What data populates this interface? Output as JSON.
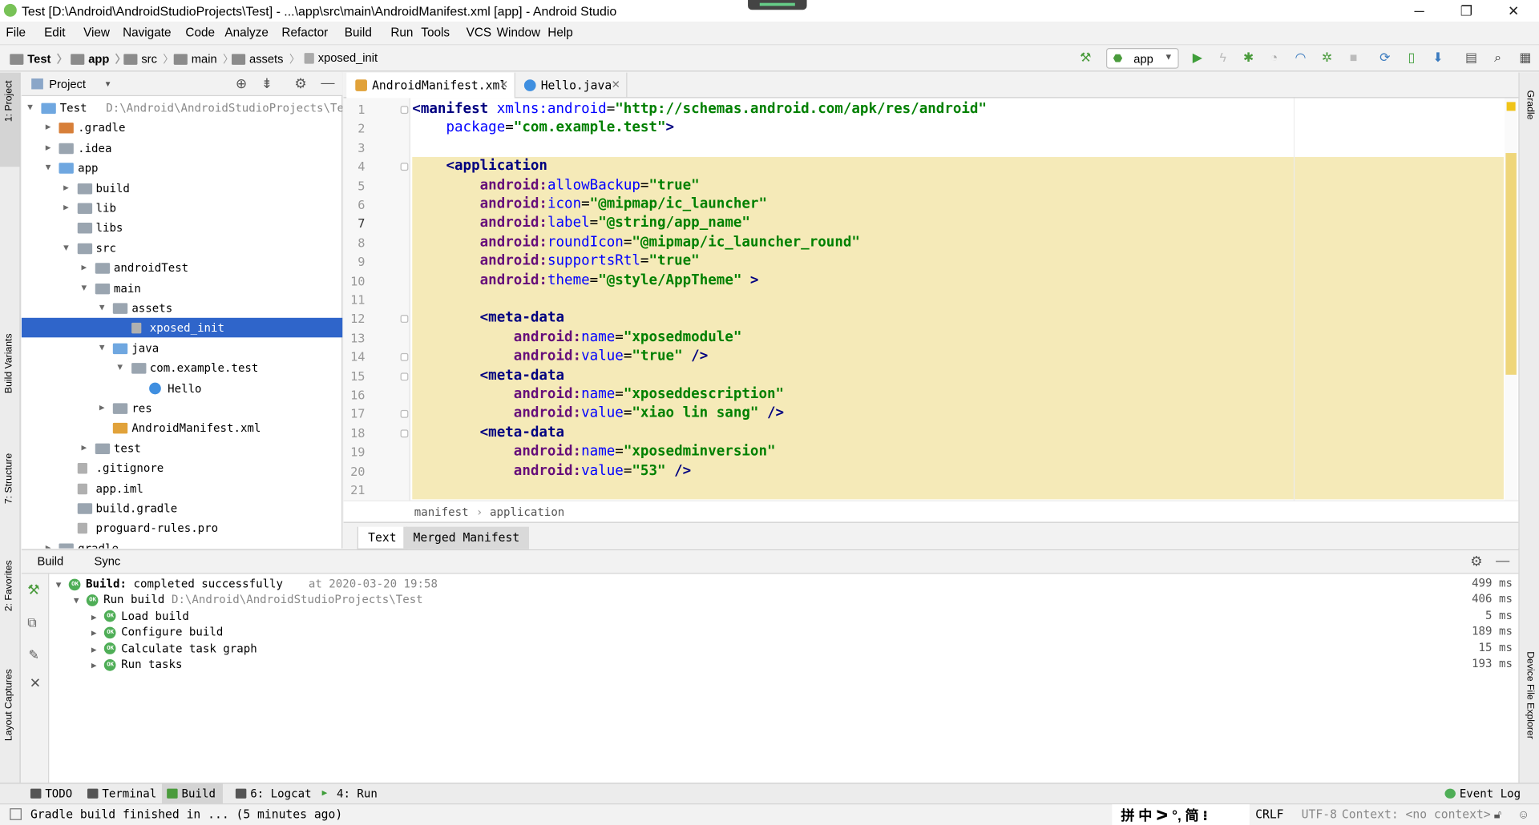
{
  "window": {
    "title": "Test [D:\\Android\\AndroidStudioProjects\\Test] - ...\\app\\src\\main\\AndroidManifest.xml [app] - Android Studio"
  },
  "menu": [
    "File",
    "Edit",
    "View",
    "Navigate",
    "Code",
    "Analyze",
    "Refactor",
    "Build",
    "Run",
    "Tools",
    "VCS",
    "Window",
    "Help"
  ],
  "breadcrumbs": [
    "Test",
    "app",
    "src",
    "main",
    "assets",
    "xposed_init"
  ],
  "toolbar": {
    "run_config": "app"
  },
  "left_strip": {
    "project": "1: Project",
    "build_variants": "Build Variants",
    "structure": "7: Structure",
    "favorites": "2: Favorites",
    "layout_captures": "Layout Captures"
  },
  "right_strip": {
    "gradle": "Gradle",
    "device_file_explorer": "Device File Explorer"
  },
  "project_panel": {
    "title": "Project",
    "tree": [
      {
        "label": "Test",
        "path": "D:\\Android\\AndroidStudioProjects\\Test",
        "depth": 0,
        "expanded": "open",
        "icon": "module"
      },
      {
        "label": ".gradle",
        "depth": 1,
        "expanded": "closed",
        "icon": "folder-orange"
      },
      {
        "label": ".idea",
        "depth": 1,
        "expanded": "closed",
        "icon": "folder"
      },
      {
        "label": "app",
        "depth": 1,
        "expanded": "open",
        "icon": "module"
      },
      {
        "label": "build",
        "depth": 2,
        "expanded": "closed",
        "icon": "folder"
      },
      {
        "label": "lib",
        "depth": 2,
        "expanded": "closed",
        "icon": "folder"
      },
      {
        "label": "libs",
        "depth": 2,
        "expanded": "none",
        "icon": "folder"
      },
      {
        "label": "src",
        "depth": 2,
        "expanded": "open",
        "icon": "folder"
      },
      {
        "label": "androidTest",
        "depth": 3,
        "expanded": "closed",
        "icon": "folder"
      },
      {
        "label": "main",
        "depth": 3,
        "expanded": "open",
        "icon": "folder"
      },
      {
        "label": "assets",
        "depth": 4,
        "expanded": "open",
        "icon": "folder"
      },
      {
        "label": "xposed_init",
        "depth": 5,
        "expanded": "none",
        "icon": "file",
        "selected": true
      },
      {
        "label": "java",
        "depth": 4,
        "expanded": "open",
        "icon": "folder-blue"
      },
      {
        "label": "com.example.test",
        "depth": 5,
        "expanded": "open",
        "icon": "package"
      },
      {
        "label": "Hello",
        "depth": 6,
        "expanded": "none",
        "icon": "class"
      },
      {
        "label": "res",
        "depth": 4,
        "expanded": "closed",
        "icon": "folder"
      },
      {
        "label": "AndroidManifest.xml",
        "depth": 4,
        "expanded": "none",
        "icon": "xml"
      },
      {
        "label": "test",
        "depth": 3,
        "expanded": "closed",
        "icon": "folder"
      },
      {
        "label": ".gitignore",
        "depth": 2,
        "expanded": "none",
        "icon": "file"
      },
      {
        "label": "app.iml",
        "depth": 2,
        "expanded": "none",
        "icon": "file"
      },
      {
        "label": "build.gradle",
        "depth": 2,
        "expanded": "none",
        "icon": "gradle"
      },
      {
        "label": "proguard-rules.pro",
        "depth": 2,
        "expanded": "none",
        "icon": "file"
      },
      {
        "label": "gradle",
        "depth": 1,
        "expanded": "closed",
        "icon": "folder"
      }
    ]
  },
  "editor": {
    "tabs": [
      {
        "label": "AndroidManifest.xml",
        "active": true
      },
      {
        "label": "Hello.java",
        "active": false
      }
    ],
    "line_numbers": [
      "1",
      "2",
      "3",
      "4",
      "5",
      "6",
      "7",
      "8",
      "9",
      "10",
      "11",
      "12",
      "13",
      "14",
      "15",
      "16",
      "17",
      "18",
      "19",
      "20",
      "21"
    ],
    "code": [
      [
        [
          "tg",
          "<manifest "
        ],
        [
          "at",
          "xmlns:android"
        ],
        [
          "pl",
          "="
        ],
        [
          "av",
          "\"http://schemas.android.com/apk/res/android\""
        ]
      ],
      [
        [
          "pl",
          "    "
        ],
        [
          "at",
          "package"
        ],
        [
          "pl",
          "="
        ],
        [
          "av",
          "\"com.example.test\""
        ],
        [
          "tg",
          ">"
        ]
      ],
      [],
      [
        [
          "pl",
          "    "
        ],
        [
          "tg",
          "<application"
        ]
      ],
      [
        [
          "pl",
          "        "
        ],
        [
          "ns",
          "android:"
        ],
        [
          "at",
          "allowBackup"
        ],
        [
          "pl",
          "="
        ],
        [
          "av",
          "\"true\""
        ]
      ],
      [
        [
          "pl",
          "        "
        ],
        [
          "ns",
          "android:"
        ],
        [
          "at",
          "icon"
        ],
        [
          "pl",
          "="
        ],
        [
          "av",
          "\"@mipmap/ic_launcher\""
        ]
      ],
      [
        [
          "pl",
          "        "
        ],
        [
          "ns",
          "android:"
        ],
        [
          "at",
          "label"
        ],
        [
          "pl",
          "="
        ],
        [
          "av",
          "\"@string/app_name\""
        ]
      ],
      [
        [
          "pl",
          "        "
        ],
        [
          "ns",
          "android:"
        ],
        [
          "at",
          "roundIcon"
        ],
        [
          "pl",
          "="
        ],
        [
          "av",
          "\"@mipmap/ic_launcher_round\""
        ]
      ],
      [
        [
          "pl",
          "        "
        ],
        [
          "ns",
          "android:"
        ],
        [
          "at",
          "supportsRtl"
        ],
        [
          "pl",
          "="
        ],
        [
          "av",
          "\"true\""
        ]
      ],
      [
        [
          "pl",
          "        "
        ],
        [
          "ns",
          "android:"
        ],
        [
          "at",
          "theme"
        ],
        [
          "pl",
          "="
        ],
        [
          "av",
          "\"@style/AppTheme\""
        ],
        [
          "tg",
          " >"
        ]
      ],
      [],
      [
        [
          "pl",
          "        "
        ],
        [
          "tg",
          "<meta-data"
        ]
      ],
      [
        [
          "pl",
          "            "
        ],
        [
          "ns",
          "android:"
        ],
        [
          "at",
          "name"
        ],
        [
          "pl",
          "="
        ],
        [
          "av",
          "\"xposedmodule\""
        ]
      ],
      [
        [
          "pl",
          "            "
        ],
        [
          "ns",
          "android:"
        ],
        [
          "at",
          "value"
        ],
        [
          "pl",
          "="
        ],
        [
          "av",
          "\"true\""
        ],
        [
          "tg",
          " />"
        ]
      ],
      [
        [
          "pl",
          "        "
        ],
        [
          "tg",
          "<meta-data"
        ]
      ],
      [
        [
          "pl",
          "            "
        ],
        [
          "ns",
          "android:"
        ],
        [
          "at",
          "name"
        ],
        [
          "pl",
          "="
        ],
        [
          "av",
          "\"xposeddescription\""
        ]
      ],
      [
        [
          "pl",
          "            "
        ],
        [
          "ns",
          "android:"
        ],
        [
          "at",
          "value"
        ],
        [
          "pl",
          "="
        ],
        [
          "av",
          "\"xiao lin sang\""
        ],
        [
          "tg",
          " />"
        ]
      ],
      [
        [
          "pl",
          "        "
        ],
        [
          "tg",
          "<meta-data"
        ]
      ],
      [
        [
          "pl",
          "            "
        ],
        [
          "ns",
          "android:"
        ],
        [
          "at",
          "name"
        ],
        [
          "pl",
          "="
        ],
        [
          "av",
          "\"xposedminversion\""
        ]
      ],
      [
        [
          "pl",
          "            "
        ],
        [
          "ns",
          "android:"
        ],
        [
          "at",
          "value"
        ],
        [
          "pl",
          "="
        ],
        [
          "av",
          "\"53\""
        ],
        [
          "tg",
          " />"
        ]
      ],
      []
    ],
    "breadcrumb": [
      "manifest",
      "application"
    ],
    "bottom_tabs": [
      "Text",
      "Merged Manifest"
    ]
  },
  "build_panel": {
    "tabs": [
      "Build",
      "Sync"
    ],
    "rows": [
      {
        "label": "Build:",
        "detail": "completed successfully",
        "time": "at 2020-03-20 19:58",
        "duration": "499 ms",
        "depth": 0
      },
      {
        "label": "Run build",
        "detail": "D:\\Android\\AndroidStudioProjects\\Test",
        "duration": "406 ms",
        "depth": 1
      },
      {
        "label": "Load build",
        "duration": "5 ms",
        "depth": 2
      },
      {
        "label": "Configure build",
        "duration": "189 ms",
        "depth": 2
      },
      {
        "label": "Calculate task graph",
        "duration": "15 ms",
        "depth": 2
      },
      {
        "label": "Run tasks",
        "duration": "193 ms",
        "depth": 2
      }
    ],
    "ok_badge": "OK"
  },
  "bottom_tabs": [
    "TODO",
    "Terminal",
    "Build",
    "6: Logcat",
    "4: Run",
    "Event Log"
  ],
  "status": {
    "message": "Gradle build finished in ... (5 minutes ago)",
    "ime": "拼 中 ᐳ °, 简 ⁝",
    "line_sep": "CRLF",
    "encoding": "UTF-8",
    "context": "Context: <no context>"
  },
  "colors": {
    "selection": "#2f65ca",
    "highlight": "#f5eab8",
    "tag": "#000080",
    "attr": "#0000ff",
    "value": "#008000",
    "ok": "#4fae57"
  }
}
